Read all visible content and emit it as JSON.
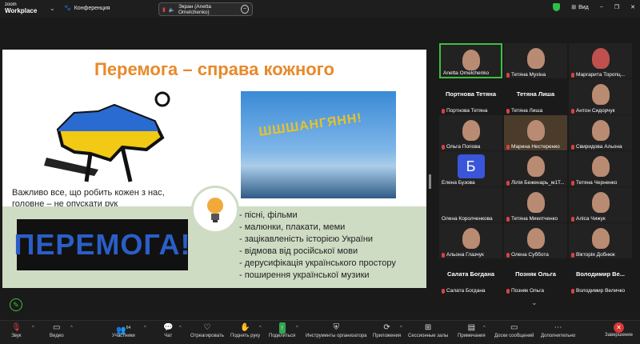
{
  "app": {
    "logo_line1": "zoom",
    "logo_line2": "Workplace",
    "meeting_label": "Конференция",
    "share_text": "Экран (Anetta Omelchenko)",
    "view_label": "Вид"
  },
  "slide": {
    "title": "Перемога – справа кожного",
    "subtext_1": "Важливо все, що робить кожен з нас,",
    "subtext_2": "головне – не опускати рук",
    "peremoga_text": "ПЕРЕМОГА!",
    "photo_text": "ШШШАНГЯНН!",
    "bullets": [
      "- пісні, фільми",
      "- малюнки, плакати, меми",
      "- зацікавленість історією України",
      "- відмова від російської мови",
      "- дерусифікація українського простору",
      "- поширення української музики"
    ]
  },
  "participants": [
    {
      "name": "Anetta Omelchenko",
      "big": ""
    },
    {
      "name": "Тетяна Мухіна",
      "big": ""
    },
    {
      "name": "Маргарита Торопц...",
      "big": ""
    },
    {
      "name": "Портнова Тетяна",
      "big": "Портнова Тетяна"
    },
    {
      "name": "Тетяна Лиша",
      "big": "Тетяна Лиша"
    },
    {
      "name": "Антон Сидорчук",
      "big": ""
    },
    {
      "name": "Ольга Попова",
      "big": ""
    },
    {
      "name": "Марина Нестеренко",
      "big": ""
    },
    {
      "name": "Свиридова Альона",
      "big": ""
    },
    {
      "name": "Елена Бузова",
      "big": ""
    },
    {
      "name": "Лілія Беженарь_м1T...",
      "big": ""
    },
    {
      "name": "Тетяна Черненко",
      "big": ""
    },
    {
      "name": "Олена Королченкова",
      "big": ""
    },
    {
      "name": "Тетяна Микитченко",
      "big": ""
    },
    {
      "name": "Аліса Чижук",
      "big": ""
    },
    {
      "name": "Альона Глазчук",
      "big": ""
    },
    {
      "name": "Олена Суббота",
      "big": ""
    },
    {
      "name": "Вікторія Добнюк",
      "big": ""
    },
    {
      "name": "Салата Богдана",
      "big": "Салата Богдана"
    },
    {
      "name": "Позняк Ольга",
      "big": "Позняк Ольга"
    },
    {
      "name": "Володимир Величко",
      "big": "Володимир  Ве..."
    }
  ],
  "avatar_letter": "Б",
  "toolbar": {
    "audio": "Звук",
    "video": "Видео",
    "participants": "Участники",
    "participants_count": "64",
    "chat": "Чат",
    "react": "Отреагировать",
    "raise_hand": "Поднять руку",
    "share": "Поделиться",
    "host_tools": "Инструменты организатора",
    "apps": "Приложения",
    "rooms": "Сессионные залы",
    "notes": "Примечания",
    "docs": "Доски сообщений",
    "more": "Дополнительно",
    "end": "Завершение"
  }
}
